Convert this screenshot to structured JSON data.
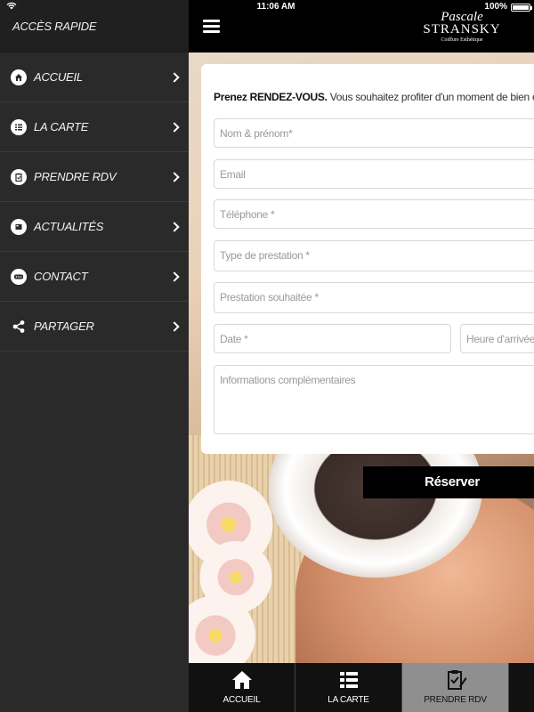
{
  "status": {
    "time": "11:06 AM",
    "battery": "100%"
  },
  "sidebar": {
    "title": "ACCÈS RAPIDE",
    "items": [
      {
        "label": "ACCUEIL",
        "icon": "home-icon"
      },
      {
        "label": "LA CARTE",
        "icon": "list-icon"
      },
      {
        "label": "PRENDRE RDV",
        "icon": "clipboard-icon"
      },
      {
        "label": "ACTUALITÉS",
        "icon": "news-icon"
      },
      {
        "label": "CONTACT",
        "icon": "contact-icon"
      },
      {
        "label": "PARTAGER",
        "icon": "share-icon"
      }
    ]
  },
  "header": {
    "logo_script": "Pascale",
    "logo_name": "STRANSKY",
    "logo_sub": "Coiffure Esthétique"
  },
  "form": {
    "intro_bold": "Prenez RENDEZ-VOUS.",
    "intro_text": " Vous souhaitez profiter d'un moment de bien être? Réserv",
    "fields": {
      "name": "Nom & prénom*",
      "email": "Email",
      "phone": "Téléphone *",
      "service_type": "Type de prestation *",
      "service": "Prestation souhaitée *",
      "date": "Date *",
      "arrival": "Heure d'arrivée *",
      "info": "Informations complémentaires"
    },
    "submit": "Réserver"
  },
  "tabs": [
    {
      "label": "ACCUEIL",
      "icon": "home-icon",
      "active": false
    },
    {
      "label": "LA CARTE",
      "icon": "list-icon",
      "active": false
    },
    {
      "label": "PRENDRE RDV",
      "icon": "clipboard-icon",
      "active": true
    }
  ]
}
